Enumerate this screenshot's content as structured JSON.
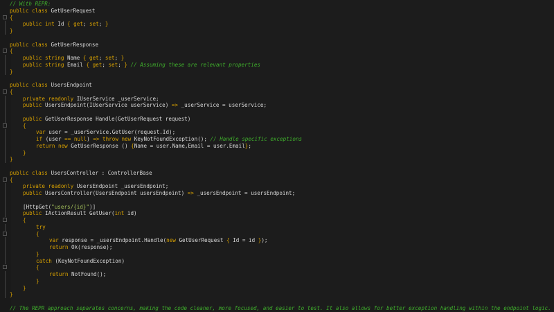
{
  "editor": {
    "colors": {
      "background": "#1c1c1c",
      "keyword": "#d7a000",
      "text": "#d8d8d8",
      "comment": "#3fae2c",
      "string": "#a5c25c"
    },
    "lines": [
      {
        "indent": 0,
        "fold": "none",
        "parts": [
          {
            "t": "cm",
            "v": "// With REPR:"
          }
        ]
      },
      {
        "indent": 0,
        "fold": "none",
        "parts": [
          {
            "t": "kw",
            "v": "public class "
          },
          {
            "t": "tx",
            "v": "GetUserRequest"
          }
        ]
      },
      {
        "indent": 0,
        "fold": "box",
        "parts": [
          {
            "t": "br",
            "v": "{"
          }
        ]
      },
      {
        "indent": 1,
        "fold": "line",
        "parts": [
          {
            "t": "kw",
            "v": "public int "
          },
          {
            "t": "tx",
            "v": "Id "
          },
          {
            "t": "br",
            "v": "{ "
          },
          {
            "t": "kw",
            "v": "get"
          },
          {
            "t": "tx",
            "v": "; "
          },
          {
            "t": "kw",
            "v": "set"
          },
          {
            "t": "tx",
            "v": "; "
          },
          {
            "t": "br",
            "v": "}"
          }
        ]
      },
      {
        "indent": 0,
        "fold": "line",
        "parts": [
          {
            "t": "br",
            "v": "}"
          }
        ]
      },
      {
        "indent": 0,
        "fold": "none",
        "parts": []
      },
      {
        "indent": 0,
        "fold": "none",
        "parts": [
          {
            "t": "kw",
            "v": "public class "
          },
          {
            "t": "tx",
            "v": "GetUserResponse"
          }
        ]
      },
      {
        "indent": 0,
        "fold": "box",
        "parts": [
          {
            "t": "br",
            "v": "{"
          }
        ]
      },
      {
        "indent": 1,
        "fold": "line",
        "parts": [
          {
            "t": "kw",
            "v": "public string "
          },
          {
            "t": "tx",
            "v": "Name "
          },
          {
            "t": "br",
            "v": "{ "
          },
          {
            "t": "kw",
            "v": "get"
          },
          {
            "t": "tx",
            "v": "; "
          },
          {
            "t": "kw",
            "v": "set"
          },
          {
            "t": "tx",
            "v": "; "
          },
          {
            "t": "br",
            "v": "}"
          }
        ]
      },
      {
        "indent": 1,
        "fold": "line",
        "parts": [
          {
            "t": "kw",
            "v": "public string "
          },
          {
            "t": "tx",
            "v": "Email "
          },
          {
            "t": "br",
            "v": "{ "
          },
          {
            "t": "kw",
            "v": "get"
          },
          {
            "t": "tx",
            "v": "; "
          },
          {
            "t": "kw",
            "v": "set"
          },
          {
            "t": "tx",
            "v": "; "
          },
          {
            "t": "br",
            "v": "} "
          },
          {
            "t": "cm",
            "v": "// Assuming these are relevant properties"
          }
        ]
      },
      {
        "indent": 0,
        "fold": "line",
        "parts": [
          {
            "t": "br",
            "v": "}"
          }
        ]
      },
      {
        "indent": 0,
        "fold": "none",
        "parts": []
      },
      {
        "indent": 0,
        "fold": "none",
        "parts": [
          {
            "t": "kw",
            "v": "public class "
          },
          {
            "t": "tx",
            "v": "UsersEndpoint"
          }
        ]
      },
      {
        "indent": 0,
        "fold": "box",
        "parts": [
          {
            "t": "br",
            "v": "{"
          }
        ]
      },
      {
        "indent": 1,
        "fold": "line",
        "parts": [
          {
            "t": "kw",
            "v": "private readonly "
          },
          {
            "t": "tx",
            "v": "IUserService _userService;"
          }
        ]
      },
      {
        "indent": 1,
        "fold": "line",
        "parts": [
          {
            "t": "kw",
            "v": "public "
          },
          {
            "t": "tx",
            "v": "UsersEndpoint(IUserService userService) "
          },
          {
            "t": "kw",
            "v": "=> "
          },
          {
            "t": "tx",
            "v": "_userService = userService;"
          }
        ]
      },
      {
        "indent": 0,
        "fold": "line",
        "parts": []
      },
      {
        "indent": 1,
        "fold": "line",
        "parts": [
          {
            "t": "kw",
            "v": "public "
          },
          {
            "t": "tx",
            "v": "GetUserResponse Handle(GetUserRequest request)"
          }
        ]
      },
      {
        "indent": 1,
        "fold": "box",
        "parts": [
          {
            "t": "br",
            "v": "{"
          }
        ]
      },
      {
        "indent": 2,
        "fold": "line",
        "parts": [
          {
            "t": "kw",
            "v": "var "
          },
          {
            "t": "tx",
            "v": "user = _userService.GetUser(request.Id);"
          }
        ]
      },
      {
        "indent": 2,
        "fold": "line",
        "parts": [
          {
            "t": "kw",
            "v": "if "
          },
          {
            "t": "tx",
            "v": "(user "
          },
          {
            "t": "kw",
            "v": "== null"
          },
          {
            "t": "tx",
            "v": ") "
          },
          {
            "t": "kw",
            "v": "=> throw new "
          },
          {
            "t": "tx",
            "v": "KeyNotFoundException(); "
          },
          {
            "t": "cm",
            "v": "// Handle specific exceptions"
          }
        ]
      },
      {
        "indent": 2,
        "fold": "line",
        "parts": [
          {
            "t": "kw",
            "v": "return new "
          },
          {
            "t": "tx",
            "v": "GetUserResponse () "
          },
          {
            "t": "br",
            "v": "{"
          },
          {
            "t": "tx",
            "v": "Name = user.Name,Email = user.Email"
          },
          {
            "t": "br",
            "v": "}"
          },
          {
            "t": "tx",
            "v": ";"
          }
        ]
      },
      {
        "indent": 1,
        "fold": "line",
        "parts": [
          {
            "t": "br",
            "v": "}"
          }
        ]
      },
      {
        "indent": 0,
        "fold": "line",
        "parts": [
          {
            "t": "br",
            "v": "}"
          }
        ]
      },
      {
        "indent": 0,
        "fold": "none",
        "parts": []
      },
      {
        "indent": 0,
        "fold": "none",
        "parts": [
          {
            "t": "kw",
            "v": "public class "
          },
          {
            "t": "tx",
            "v": "UsersController : ControllerBase"
          }
        ]
      },
      {
        "indent": 0,
        "fold": "box",
        "parts": [
          {
            "t": "br",
            "v": "{"
          }
        ]
      },
      {
        "indent": 1,
        "fold": "line",
        "parts": [
          {
            "t": "kw",
            "v": "private readonly "
          },
          {
            "t": "tx",
            "v": "UsersEndpoint _usersEndpoint;"
          }
        ]
      },
      {
        "indent": 1,
        "fold": "line",
        "parts": [
          {
            "t": "kw",
            "v": "public "
          },
          {
            "t": "tx",
            "v": "UsersController(UsersEndpoint usersEndpoint) "
          },
          {
            "t": "kw",
            "v": "=> "
          },
          {
            "t": "tx",
            "v": "_usersEndpoint = usersEndpoint;"
          }
        ]
      },
      {
        "indent": 0,
        "fold": "line",
        "parts": []
      },
      {
        "indent": 1,
        "fold": "line",
        "parts": [
          {
            "t": "tx",
            "v": "[HttpGet("
          },
          {
            "t": "st",
            "v": "\"users/{id}\""
          },
          {
            "t": "tx",
            "v": ")]"
          }
        ]
      },
      {
        "indent": 1,
        "fold": "line",
        "parts": [
          {
            "t": "kw",
            "v": "public "
          },
          {
            "t": "tx",
            "v": "IActionResult GetUser("
          },
          {
            "t": "kw",
            "v": "int "
          },
          {
            "t": "tx",
            "v": "id)"
          }
        ]
      },
      {
        "indent": 1,
        "fold": "box",
        "parts": [
          {
            "t": "br",
            "v": "{"
          }
        ]
      },
      {
        "indent": 2,
        "fold": "line",
        "parts": [
          {
            "t": "kw",
            "v": "try"
          }
        ]
      },
      {
        "indent": 2,
        "fold": "box",
        "parts": [
          {
            "t": "br",
            "v": "{"
          }
        ]
      },
      {
        "indent": 3,
        "fold": "line",
        "parts": [
          {
            "t": "kw",
            "v": "var "
          },
          {
            "t": "tx",
            "v": "response = _usersEndpoint.Handle("
          },
          {
            "t": "kw",
            "v": "new "
          },
          {
            "t": "tx",
            "v": "GetUserRequest "
          },
          {
            "t": "br",
            "v": "{ "
          },
          {
            "t": "tx",
            "v": "Id = id "
          },
          {
            "t": "br",
            "v": "}"
          },
          {
            "t": "tx",
            "v": ");"
          }
        ]
      },
      {
        "indent": 3,
        "fold": "line",
        "parts": [
          {
            "t": "kw",
            "v": "return "
          },
          {
            "t": "tx",
            "v": "Ok(response);"
          }
        ]
      },
      {
        "indent": 2,
        "fold": "line",
        "parts": [
          {
            "t": "br",
            "v": "}"
          }
        ]
      },
      {
        "indent": 2,
        "fold": "line",
        "parts": [
          {
            "t": "kw",
            "v": "catch "
          },
          {
            "t": "tx",
            "v": "(KeyNotFoundException)"
          }
        ]
      },
      {
        "indent": 2,
        "fold": "box",
        "parts": [
          {
            "t": "br",
            "v": "{"
          }
        ]
      },
      {
        "indent": 3,
        "fold": "line",
        "parts": [
          {
            "t": "kw",
            "v": "return "
          },
          {
            "t": "tx",
            "v": "NotFound();"
          }
        ]
      },
      {
        "indent": 2,
        "fold": "line",
        "parts": [
          {
            "t": "br",
            "v": "}"
          }
        ]
      },
      {
        "indent": 1,
        "fold": "line",
        "parts": [
          {
            "t": "br",
            "v": "}"
          }
        ]
      },
      {
        "indent": 0,
        "fold": "line",
        "parts": [
          {
            "t": "br",
            "v": "}"
          }
        ]
      },
      {
        "indent": 0,
        "fold": "none",
        "parts": []
      },
      {
        "indent": 0,
        "fold": "none",
        "parts": [
          {
            "t": "cm",
            "v": "// The REPR approach separates concerns, making the code cleaner, more focused, and easier to test. It also allows for better exception handling within the endpoint logic."
          }
        ]
      }
    ]
  }
}
